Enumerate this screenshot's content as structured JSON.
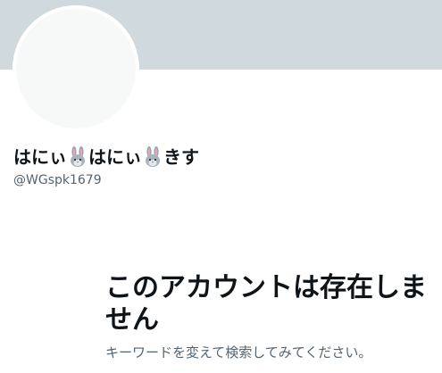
{
  "profile": {
    "name_parts": [
      "はにぃ",
      "はにぃ",
      "きす"
    ],
    "name_icon": "rabbit-face-icon",
    "handle": "@WGspk1679"
  },
  "empty_state": {
    "title": "このアカウントは存在しません",
    "description": "キーワードを変えて検索してみてください。"
  },
  "colors": {
    "banner": "#cfd9de",
    "avatar_fill": "#f7f9f9",
    "text_primary": "#0f1419",
    "text_secondary": "#536471"
  }
}
